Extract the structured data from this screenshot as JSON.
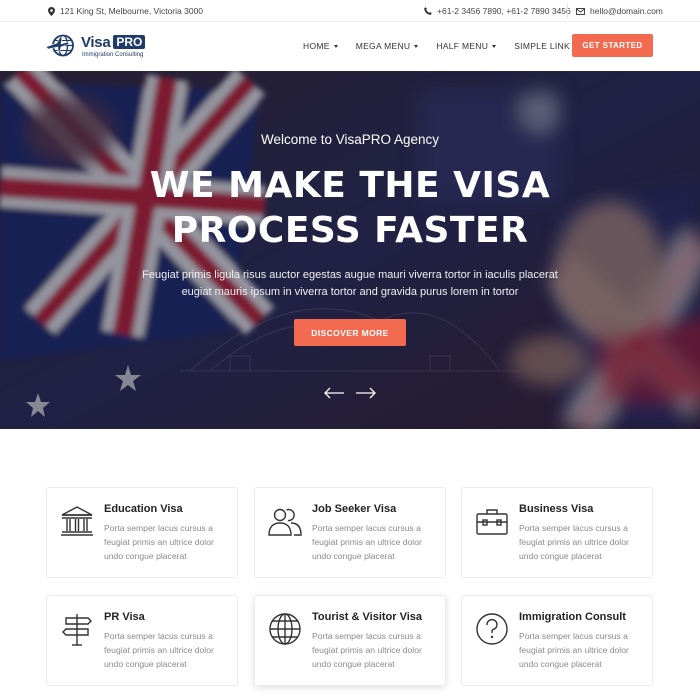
{
  "topbar": {
    "address": "121 King St, Melbourne, Victoria 3000",
    "phones": "+61-2 3456 7890,  +61-2 7890 3456",
    "email": "hello@domain.com"
  },
  "logo": {
    "word": "Visa",
    "badge": "PRO",
    "tagline": "Immigration Consulting"
  },
  "nav": {
    "items": [
      {
        "label": "HOME",
        "has_dropdown": true
      },
      {
        "label": "MEGA MENU",
        "has_dropdown": true
      },
      {
        "label": "HALF MENU",
        "has_dropdown": true
      },
      {
        "label": "SIMPLE LINK",
        "has_dropdown": false
      }
    ],
    "cta": "GET STARTED"
  },
  "hero": {
    "eyebrow": "Welcome to VisaPRO Agency",
    "title_line1": "WE MAKE THE VISA",
    "title_line2": "PROCESS FASTER",
    "subtitle_line1": "Feugiat primis ligula risus auctor egestas augue mauri viverra tortor in iaculis placerat",
    "subtitle_line2": "eugiat mauris ipsum in viverra tortor and gravida purus lorem in tortor",
    "button": "DISCOVER MORE"
  },
  "services": [
    {
      "title": "Education Visa",
      "icon": "bank-building-icon",
      "desc": "Porta semper lacus cursus a feugiat primis an ultrice dolor undo congue placerat"
    },
    {
      "title": "Job Seeker Visa",
      "icon": "users-icon",
      "desc": "Porta semper lacus cursus a feugiat primis an ultrice dolor undo congue placerat"
    },
    {
      "title": "Business Visa",
      "icon": "briefcase-icon",
      "desc": "Porta semper lacus cursus a feugiat primis an ultrice dolor undo congue placerat"
    },
    {
      "title": "PR Visa",
      "icon": "signpost-icon",
      "desc": "Porta semper lacus cursus a feugiat primis an ultrice dolor undo congue placerat"
    },
    {
      "title": "Tourist & Visitor Visa",
      "icon": "globe-icon",
      "desc": "Porta semper lacus cursus a feugiat primis an ultrice dolor undo congue placerat"
    },
    {
      "title": "Immigration Consult",
      "icon": "question-circle-icon",
      "desc": "Porta semper lacus cursus a feugiat primis an ultrice dolor undo congue placerat"
    }
  ],
  "colors": {
    "accent": "#f26b50",
    "brand": "#1f3b6b"
  }
}
